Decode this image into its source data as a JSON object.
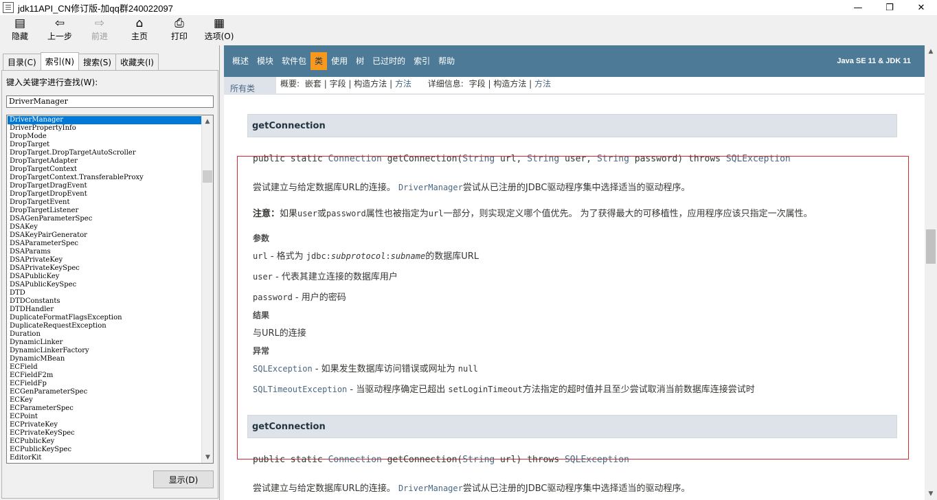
{
  "window": {
    "title": "jdk11API_CN修订版-加qq群240022097",
    "minimize": "—",
    "maximize": "❐",
    "close": "✕"
  },
  "toolbar": {
    "hide": "隐藏",
    "back": "上一步",
    "forward": "前进",
    "home": "主页",
    "print": "打印",
    "options": "选项(O)"
  },
  "left": {
    "tabs": [
      "目录(C)",
      "索引(N)",
      "搜索(S)",
      "收藏夹(I)"
    ],
    "keyword_label": "键入关键字进行查找(W):",
    "keyword_value": "DriverManager",
    "items": [
      "DriverManager",
      "DriverPropertyInfo",
      "DropMode",
      "DropTarget",
      "DropTarget.DropTargetAutoScroller",
      "DropTargetAdapter",
      "DropTargetContext",
      "DropTargetContext.TransferableProxy",
      "DropTargetDragEvent",
      "DropTargetDropEvent",
      "DropTargetEvent",
      "DropTargetListener",
      "DSAGenParameterSpec",
      "DSAKey",
      "DSAKeyPairGenerator",
      "DSAParameterSpec",
      "DSAParams",
      "DSAPrivateKey",
      "DSAPrivateKeySpec",
      "DSAPublicKey",
      "DSAPublicKeySpec",
      "DTD",
      "DTDConstants",
      "DTDHandler",
      "DuplicateFormatFlagsException",
      "DuplicateRequestException",
      "Duration",
      "DynamicLinker",
      "DynamicLinkerFactory",
      "DynamicMBean",
      "ECField",
      "ECFieldF2m",
      "ECFieldFp",
      "ECGenParameterSpec",
      "ECKey",
      "ECParameterSpec",
      "ECPoint",
      "ECPrivateKey",
      "ECPrivateKeySpec",
      "ECPublicKey",
      "ECPublicKeySpec",
      "EditorKit"
    ],
    "show_button": "显示(D)"
  },
  "nav": {
    "links": [
      "概述",
      "模块",
      "软件包",
      "类",
      "使用",
      "树",
      "已过时的",
      "索引",
      "帮助"
    ],
    "active_index": 3,
    "right": "Java SE 11 & JDK 11",
    "all_classes": "所有类",
    "summary_label": "概要:",
    "summary_items": [
      "嵌套",
      "字段",
      "构造方法",
      "方法"
    ],
    "detail_label": "详细信息:",
    "detail_items": [
      "字段",
      "构造方法",
      "方法"
    ]
  },
  "method1": {
    "name": "getConnection",
    "sig_prefix": "public static ",
    "sig_ret": "Connection",
    "sig_name": " getConnection(",
    "p1_type": "String",
    "p1_name": " url, ",
    "p2_type": "String",
    "p2_name": " user, ",
    "p3_type": "String",
    "p3_name": " password) throws ",
    "sig_exc": "SQLException",
    "desc_a": "尝试建立与给定数据库URL的连接。 ",
    "desc_code": "DriverManager",
    "desc_b": "尝试从已注册的JDBC驱动程序集中选择适当的驱动程序。",
    "note_label": "注意：",
    "note_a": "如果",
    "note_user": "user",
    "note_or": "或",
    "note_pw": "password",
    "note_b": "属性也被指定为",
    "note_url": "url",
    "note_c": "一部分，则实现定义哪个值优先。 为了获得最大的可移植性，应用程序应该只指定一次属性。",
    "params_label": "参数",
    "param_url": "url",
    "param_url_desc_a": " - 格式为 ",
    "param_url_code_a": "jdbc:",
    "param_url_code_b": "subprotocol",
    "param_url_code_c": ":",
    "param_url_code_d": "subname",
    "param_url_desc_b": "的数据库URL",
    "param_user": "user",
    "param_user_desc": " - 代表其建立连接的数据库用户",
    "param_pw": "password",
    "param_pw_desc": " - 用户的密码",
    "result_label": "结果",
    "result_text": "与URL的连接",
    "exc_label": "异常",
    "exc1": "SQLException",
    "exc1_desc_a": " - 如果发生数据库访问错误或网址为 ",
    "exc1_null": "null",
    "exc2": "SQLTimeoutException",
    "exc2_desc_a": " - 当驱动程序确定已超出 ",
    "exc2_code": "setLoginTimeout",
    "exc2_desc_b": "方法指定的超时值并且至少尝试取消当前数据库连接尝试时"
  },
  "method2": {
    "name": "getConnection",
    "sig_prefix": "public static ",
    "sig_ret": "Connection",
    "sig_name": " getConnection(",
    "p1_type": "String",
    "p1_name": " url) throws ",
    "sig_exc": "SQLException",
    "desc_a": "尝试建立与给定数据库URL的连接。 ",
    "desc_code": "DriverManager",
    "desc_b": "尝试从已注册的JDBC驱动程序集中选择适当的驱动程序。"
  }
}
